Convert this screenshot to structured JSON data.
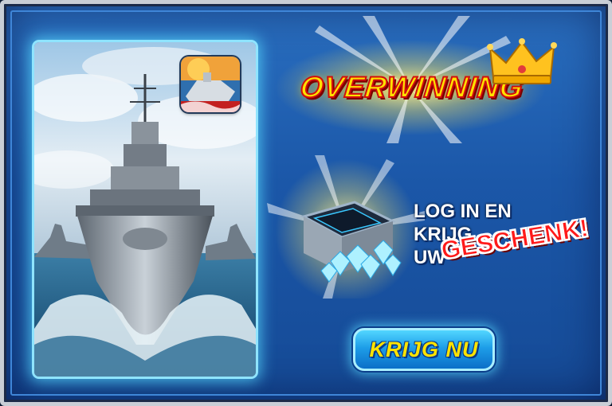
{
  "dialog": {
    "title": "OVERWINNING",
    "message_lines": [
      "LOG IN EN",
      "KRIJG",
      "UW"
    ],
    "highlight": "GESCHENK!",
    "button_label": "KRIJG NU"
  },
  "colors": {
    "background": "#1b57a8",
    "title_fill": "#ffe100",
    "title_stroke": "#d10d0d",
    "highlight": "#ff1a1a",
    "button": "#1e9ee8",
    "button_text": "#ffe300",
    "card_glow": "#8fe4ff"
  },
  "icons": {
    "crown": "crown-icon",
    "app": "battleship-app-icon",
    "gift": "gem-chest-icon"
  }
}
